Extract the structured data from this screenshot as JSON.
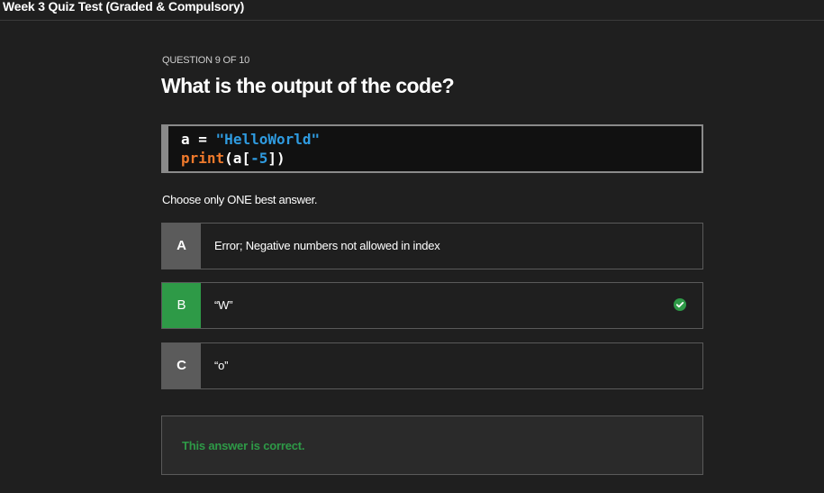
{
  "header": {
    "title": "Week 3 Quiz Test (Graded & Compulsory)"
  },
  "question": {
    "counter": "QUESTION 9 OF 10",
    "title": "What is the output of the code?",
    "code": {
      "line1": {
        "var": "a",
        "op": " = ",
        "str": "\"HelloWorld\""
      },
      "line2": {
        "fn": "print",
        "open": "(a[",
        "num": "-5",
        "close": "])"
      }
    },
    "instruction": "Choose only ONE best answer."
  },
  "options": [
    {
      "letter": "A",
      "text": "Error; Negative numbers not allowed in index",
      "correct": false
    },
    {
      "letter": "B",
      "text": "“W”",
      "correct": true
    },
    {
      "letter": "C",
      "text": "“o”",
      "correct": false
    }
  ],
  "feedback": {
    "text": "This answer is correct."
  },
  "colors": {
    "background": "#1f1f1f",
    "correct_green": "#2e9a47",
    "letter_grey": "#5b5b5b",
    "code_string": "#2f9be0",
    "code_function": "#f07a2c"
  }
}
